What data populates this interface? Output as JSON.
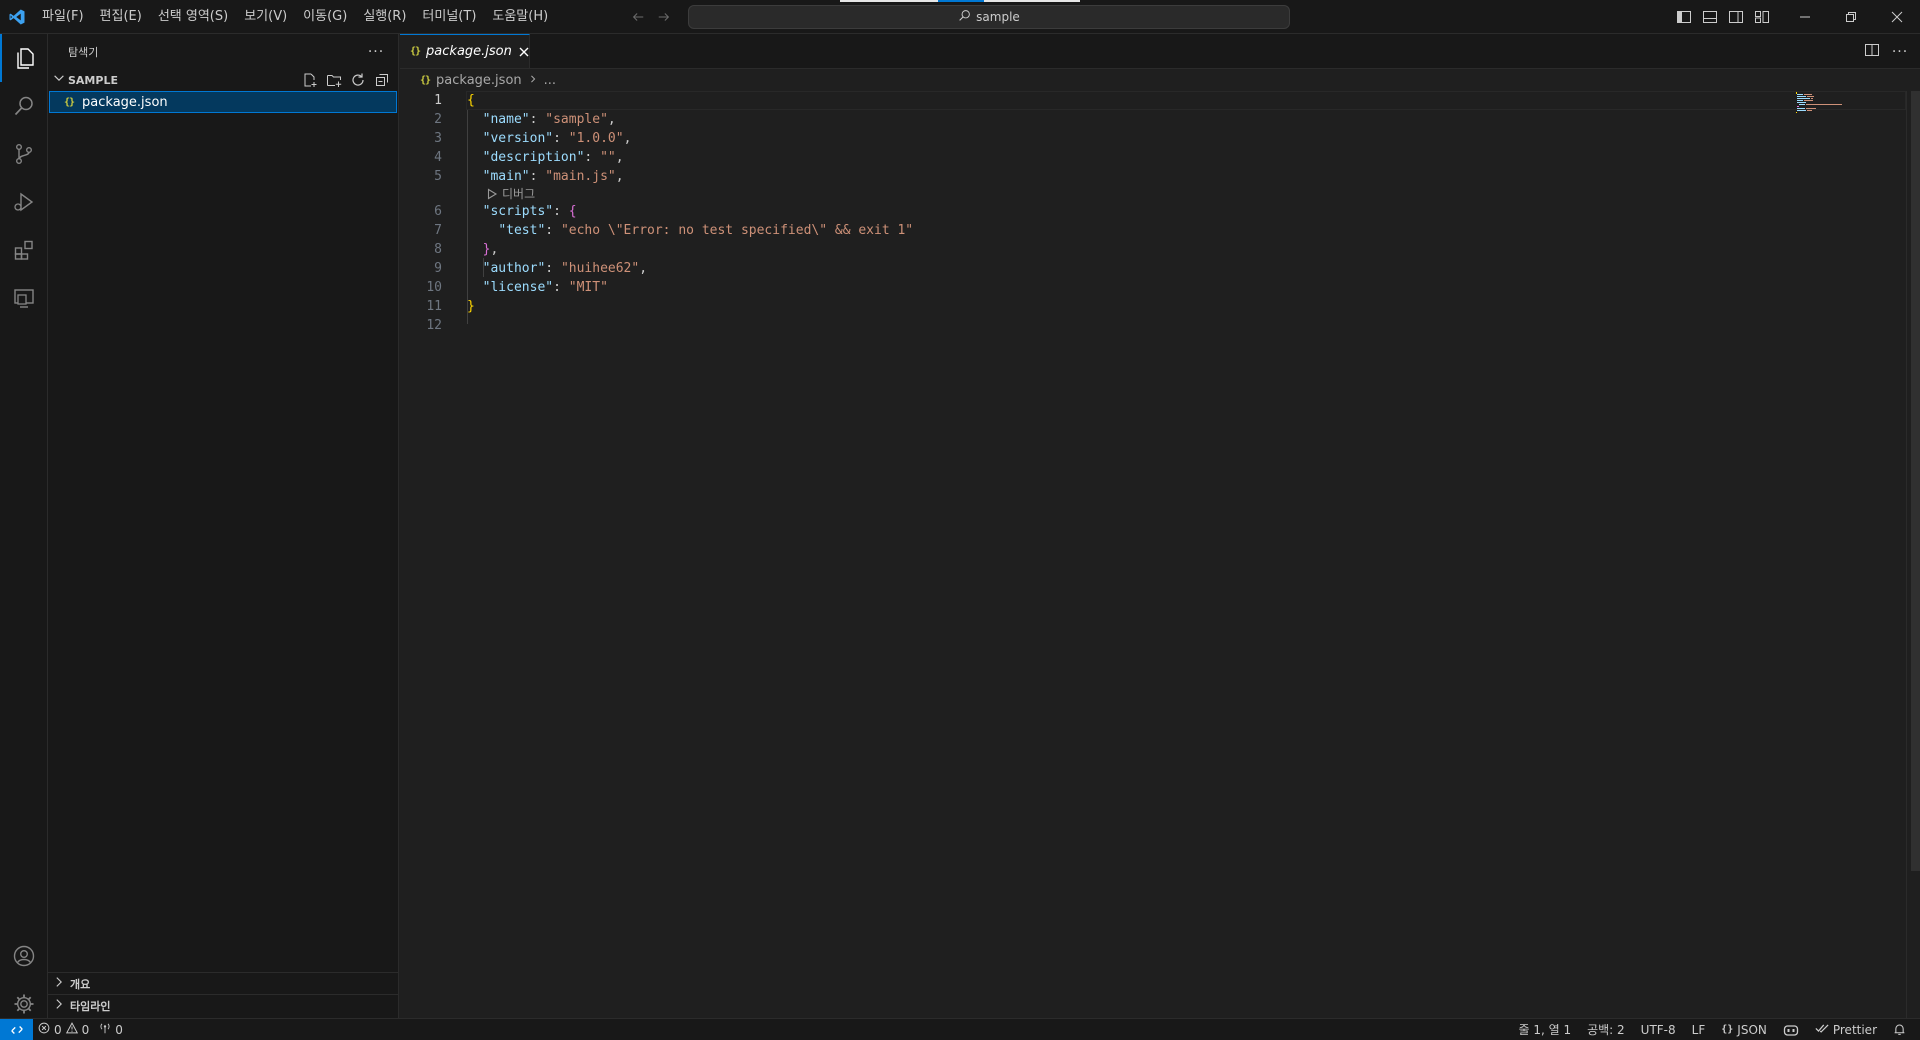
{
  "titlebar": {
    "menus": [
      "파일(F)",
      "편집(E)",
      "선택 영역(S)",
      "보기(V)",
      "이동(G)",
      "실행(R)",
      "터미널(T)",
      "도움말(H)"
    ],
    "search_label": "sample"
  },
  "sidebar": {
    "title": "탐색기",
    "more_label": "···",
    "section_title": "SAMPLE",
    "file_icon": "{}",
    "file_name": "package.json",
    "outline_label": "개요",
    "timeline_label": "타임라인"
  },
  "editor": {
    "tab_icon": "{}",
    "tab_label": "package.json",
    "breadcrumb_icon": "{}",
    "breadcrumb_file": "package.json",
    "breadcrumb_more": "...",
    "more_label": "···",
    "codelens_label": "디버그",
    "line_numbers": [
      "1",
      "2",
      "3",
      "4",
      "5",
      "6",
      "7",
      "8",
      "9",
      "10",
      "11",
      "12"
    ],
    "lines": [
      [
        {
          "t": "{",
          "c": "brace"
        }
      ],
      [
        {
          "t": "  ",
          "c": "punc"
        },
        {
          "t": "\"name\"",
          "c": "key"
        },
        {
          "t": ": ",
          "c": "punc"
        },
        {
          "t": "\"sample\"",
          "c": "str"
        },
        {
          "t": ",",
          "c": "punc"
        }
      ],
      [
        {
          "t": "  ",
          "c": "punc"
        },
        {
          "t": "\"version\"",
          "c": "key"
        },
        {
          "t": ": ",
          "c": "punc"
        },
        {
          "t": "\"1.0.0\"",
          "c": "str"
        },
        {
          "t": ",",
          "c": "punc"
        }
      ],
      [
        {
          "t": "  ",
          "c": "punc"
        },
        {
          "t": "\"description\"",
          "c": "key"
        },
        {
          "t": ": ",
          "c": "punc"
        },
        {
          "t": "\"\"",
          "c": "str"
        },
        {
          "t": ",",
          "c": "punc"
        }
      ],
      [
        {
          "t": "  ",
          "c": "punc"
        },
        {
          "t": "\"main\"",
          "c": "key"
        },
        {
          "t": ": ",
          "c": "punc"
        },
        {
          "t": "\"main.js\"",
          "c": "str"
        },
        {
          "t": ",",
          "c": "punc"
        }
      ],
      [
        {
          "t": "  ",
          "c": "punc"
        },
        {
          "t": "\"scripts\"",
          "c": "key"
        },
        {
          "t": ": ",
          "c": "punc"
        },
        {
          "t": "{",
          "c": "brace2"
        }
      ],
      [
        {
          "t": "    ",
          "c": "punc"
        },
        {
          "t": "\"test\"",
          "c": "key"
        },
        {
          "t": ": ",
          "c": "punc"
        },
        {
          "t": "\"echo \\\"Error: no test specified\\\" && exit 1\"",
          "c": "str"
        }
      ],
      [
        {
          "t": "  ",
          "c": "punc"
        },
        {
          "t": "}",
          "c": "brace2"
        },
        {
          "t": ",",
          "c": "punc"
        }
      ],
      [
        {
          "t": "  ",
          "c": "punc"
        },
        {
          "t": "\"author\"",
          "c": "key"
        },
        {
          "t": ": ",
          "c": "punc"
        },
        {
          "t": "\"huihee62\"",
          "c": "str"
        },
        {
          "t": ",",
          "c": "punc"
        }
      ],
      [
        {
          "t": "  ",
          "c": "punc"
        },
        {
          "t": "\"license\"",
          "c": "key"
        },
        {
          "t": ": ",
          "c": "punc"
        },
        {
          "t": "\"MIT\"",
          "c": "str"
        }
      ],
      [
        {
          "t": "}",
          "c": "brace"
        }
      ],
      []
    ]
  },
  "statusbar": {
    "errors": "0",
    "warnings": "0",
    "ports": "0",
    "cursor_position": "줄 1, 열 1",
    "indentation": "공백: 2",
    "encoding": "UTF-8",
    "eol": "LF",
    "language_icon": "{}",
    "language": "JSON",
    "formatter": "Prettier"
  },
  "colors": {
    "accent": "#0078d4",
    "json_icon": "#cbcb41",
    "selection": "#04395e"
  }
}
